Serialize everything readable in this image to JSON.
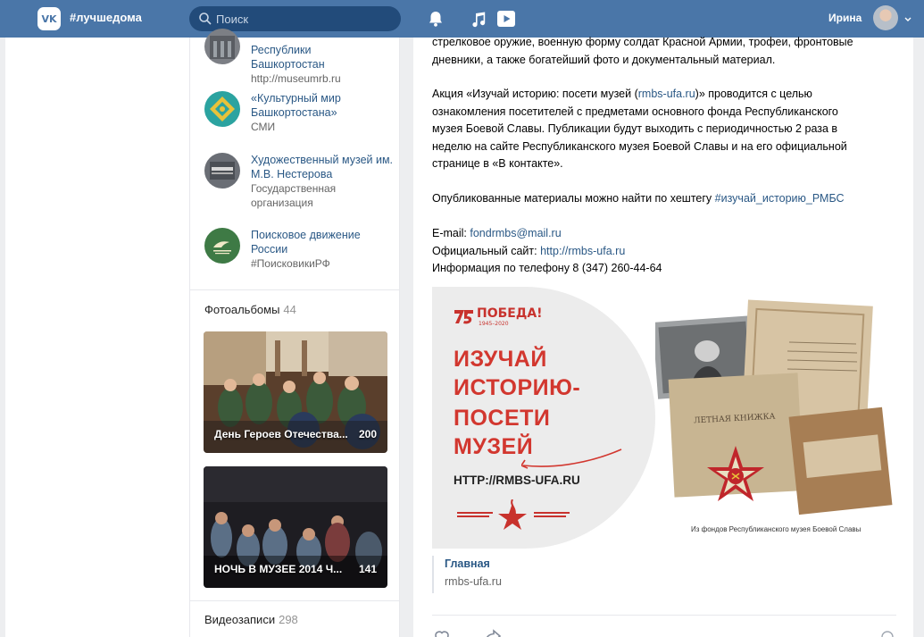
{
  "topbar": {
    "logo": "VK",
    "site_tag": "#лучшедома",
    "search_placeholder": "Поиск",
    "user_name": "Ирина",
    "icons": [
      "search-icon",
      "bell-icon",
      "music-icon",
      "play-icon",
      "chevron-down-icon"
    ]
  },
  "sidebar": {
    "orgs": [
      {
        "name": "Республики Башкортостан",
        "sub": "http://museumrb.ru"
      },
      {
        "name": "«Культурный мир Башкортостана»",
        "sub": "СМИ"
      },
      {
        "name": "Художественный музей им. М.В. Нестерова",
        "sub": "Государственная организация"
      },
      {
        "name": "Поисковое движение России",
        "sub": "#ПоисковикиРФ"
      }
    ],
    "photos_title": "Фотоальбомы",
    "photos_count": "44",
    "albums": [
      {
        "title": "День Героев Отечества...",
        "count": "200"
      },
      {
        "title": "НОЧЬ В МУЗЕЕ 2014 Ч...",
        "count": "141"
      }
    ],
    "videos_title": "Видеозаписи",
    "videos_count": "298"
  },
  "post": {
    "p1_l1": "стрелковое оружие, военную форму солдат Красной Армии, трофеи, фронтовые",
    "p1_l2": "дневники, а также богатейший фото и документальный материал.",
    "p2_l1_a": "Акция «Изучай историю: посети музей (",
    "p2_l1_link": "rmbs-ufa.ru",
    "p2_l1_b": ")» проводится с целью",
    "p2_l2": "ознакомления посетителей с предметами основного фонда Республиканского",
    "p2_l3": "музея Боевой Славы. Публикации будут выходить с периодичностью 2 раза в",
    "p2_l4": "неделю на сайте Республиканского музея Боевой Славы и на его официальной",
    "p2_l5": "странице в «В контакте».",
    "p3_a": "Опубликованные материалы можно найти по хештегу ",
    "p3_tag": "#изучай_историю_РМБС",
    "email_label": "E-mail: ",
    "email": "fondrmbs@mail.ru",
    "site_label": "Официальный сайт: ",
    "site": "http://rmbs-ufa.ru",
    "phone": "Информация по телефону 8 (347) 260-44-64",
    "poster": {
      "pobeda": "ПОБЕДА!",
      "years": "1945–2020",
      "l1": "ИЗУЧАЙ",
      "l2": "ИСТОРИЮ-",
      "l3": "ПОСЕТИ",
      "l4": "МУЗЕЙ",
      "url": "HTTP://RMBS-UFA.RU",
      "caption": "Из фондов Республиканского музея Боевой Славы",
      "book_label": "ЛЕТНАЯ КНИЖКА"
    },
    "snippet_title": "Главная",
    "snippet_url": "rmbs-ufa.ru"
  },
  "colors": {
    "header": "#4a76a8",
    "link": "#2a5885",
    "poster_red": "#d2372f"
  }
}
